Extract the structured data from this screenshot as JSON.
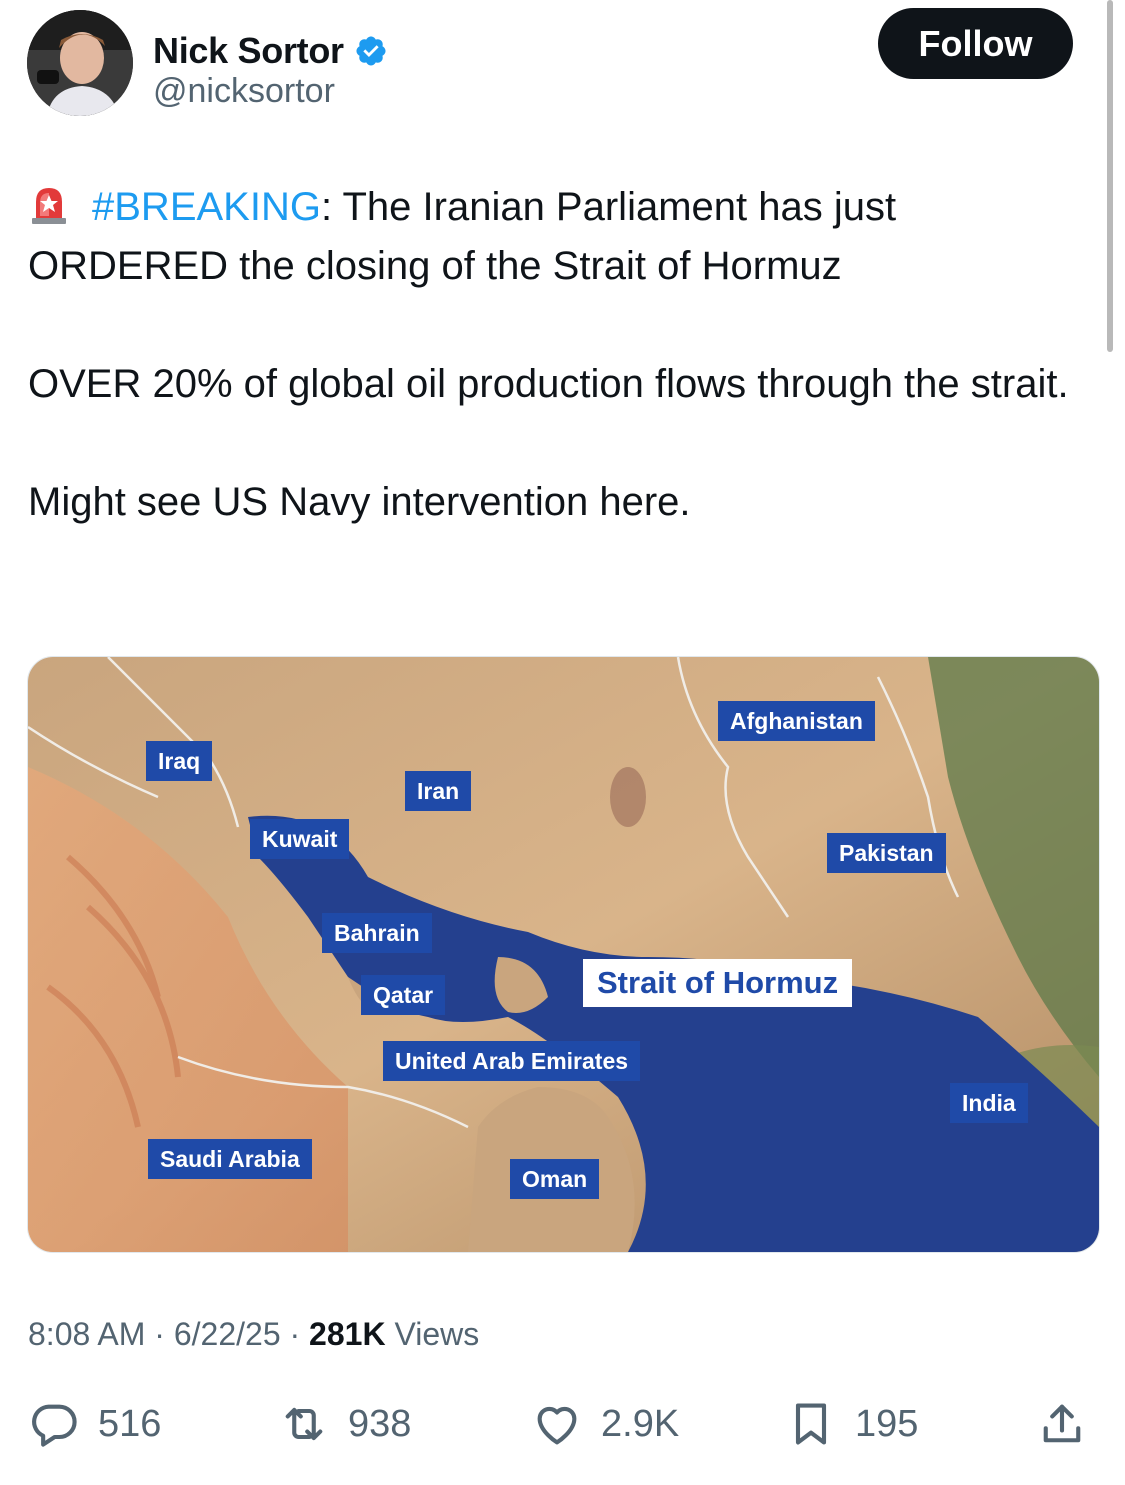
{
  "author": {
    "name": "Nick Sortor",
    "handle": "@nicksortor",
    "verified": true,
    "follow_label": "Follow"
  },
  "tweet": {
    "hashtag": "#BREAKING",
    "line1_rest": ": The Iranian Parliament has just ORDERED the closing of the Strait of Hormuz",
    "para2": "OVER 20% of global oil production flows through the strait.",
    "para3": "Might see US Navy intervention here."
  },
  "map": {
    "labels": {
      "iraq": "Iraq",
      "kuwait": "Kuwait",
      "iran": "Iran",
      "afghanistan": "Afghanistan",
      "pakistan": "Pakistan",
      "bahrain": "Bahrain",
      "qatar": "Qatar",
      "strait": "Strait of Hormuz",
      "uae": "United Arab Emirates",
      "india": "India",
      "saudi": "Saudi Arabia",
      "oman": "Oman"
    }
  },
  "meta": {
    "time": "8:08 AM",
    "sep1": " · ",
    "date": "6/22/25",
    "sep2": " · ",
    "views_count": "281K",
    "views_label": " Views"
  },
  "actions": {
    "replies": "516",
    "reposts": "938",
    "likes": "2.9K",
    "bookmarks": "195"
  },
  "colors": {
    "accent": "#1d9bf0",
    "text": "#0f1419",
    "secondary": "#536471",
    "map_label_bg": "#1f4aa8"
  }
}
